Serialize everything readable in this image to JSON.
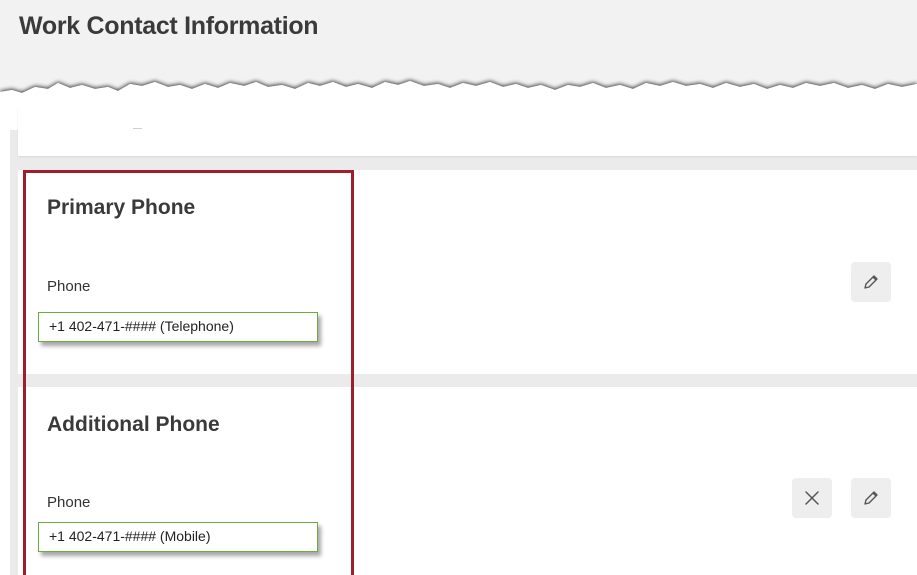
{
  "header": {
    "title": "Work Contact Information"
  },
  "primary_phone": {
    "title": "Primary Phone",
    "field_label": "Phone",
    "value": "+1 402-471-#### (Telephone)",
    "edit_icon": "pencil-icon"
  },
  "additional_phone": {
    "title": "Additional Phone",
    "field_label": "Phone",
    "value": "+1 402-471-#### (Mobile)",
    "delete_icon": "close-icon",
    "edit_icon": "pencil-icon"
  },
  "colors": {
    "highlight_border": "#a01e2c",
    "value_border": "#6cab3f",
    "background": "#ebebeb"
  }
}
